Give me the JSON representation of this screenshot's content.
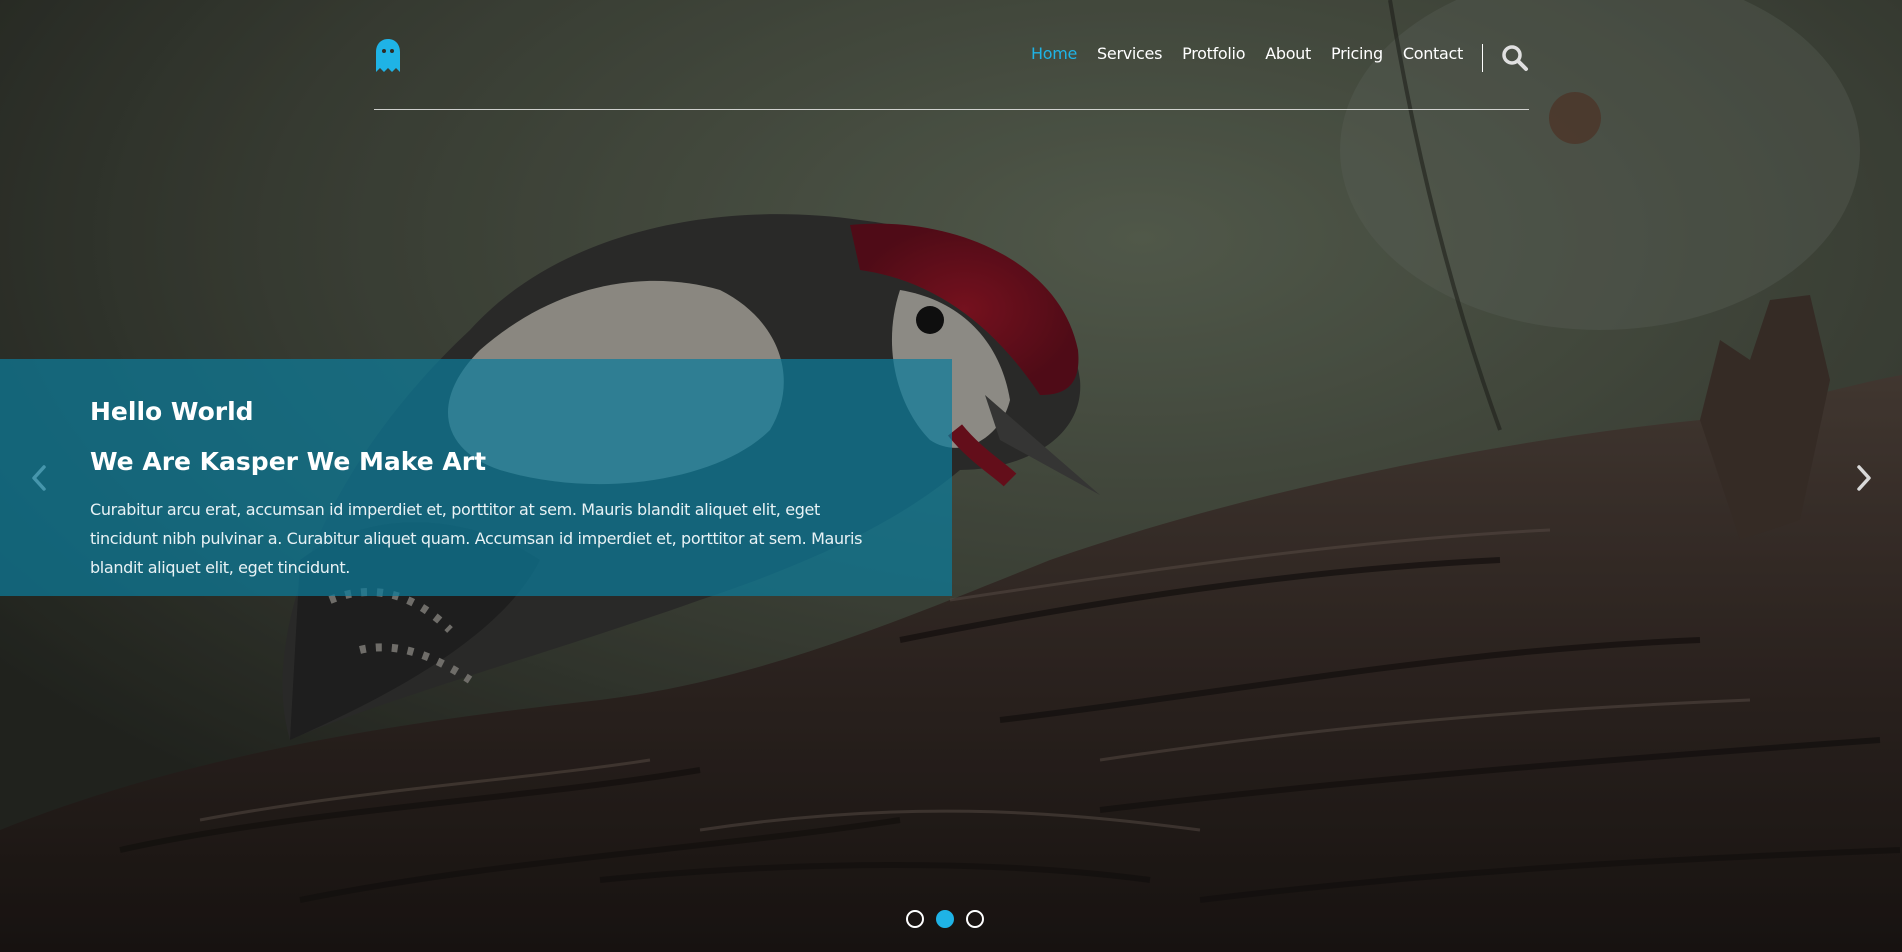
{
  "header": {
    "logo_icon": "ghost-icon",
    "nav": [
      {
        "label": "Home",
        "active": true
      },
      {
        "label": "Services",
        "active": false
      },
      {
        "label": "Protfolio",
        "active": false
      },
      {
        "label": "About",
        "active": false
      },
      {
        "label": "Pricing",
        "active": false
      },
      {
        "label": "Contact",
        "active": false
      }
    ],
    "search_icon": "search-icon"
  },
  "slider": {
    "title": "Hello World",
    "subtitle": "We Are Kasper We Make Art",
    "text": "Curabitur arcu erat, accumsan id imperdiet et, porttitor at sem. Mauris blandit aliquet elit, eget tincidunt nibh pulvinar a. Curabitur aliquet quam. Accumsan id imperdiet et, porttitor at sem. Mauris blandit aliquet elit, eget tincidunt.",
    "prev_icon": "chevron-left-icon",
    "next_icon": "chevron-right-icon",
    "dots": 3,
    "active_dot": 2
  },
  "colors": {
    "accent": "#1fb3e6",
    "caption_bg": "#0d7c9a"
  }
}
